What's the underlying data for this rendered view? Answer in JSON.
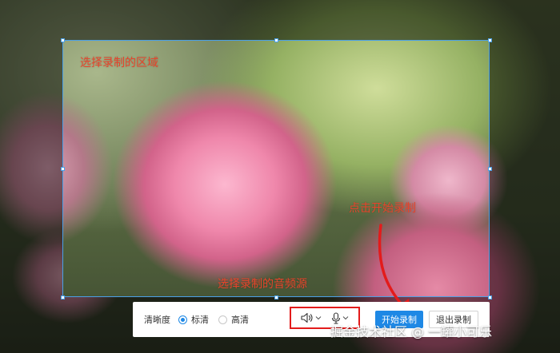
{
  "annotations": {
    "select_region": "选择录制的区域",
    "click_start": "点击开始录制",
    "select_audio": "选择录制的音频源"
  },
  "toolbar": {
    "quality_label": "清晰度",
    "quality_options": [
      {
        "label": "标清",
        "selected": true
      },
      {
        "label": "高清",
        "selected": false
      }
    ],
    "audio_sources": [
      {
        "icon": "speaker-icon"
      },
      {
        "icon": "microphone-icon"
      }
    ],
    "start_button": "开始录制",
    "exit_button": "退出录制"
  },
  "watermark": "掘金技术社区 @ 一罐小可乐",
  "colors": {
    "accent": "#1e88e5",
    "annotation": "#e8442b",
    "highlight_box": "#e31b1b",
    "selection_border": "#4aa0e8"
  }
}
